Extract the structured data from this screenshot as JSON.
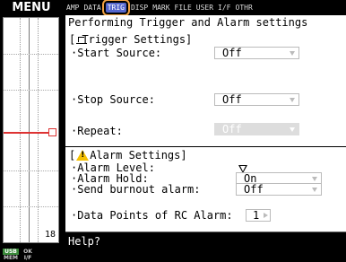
{
  "menu_label": "MENU",
  "tabs": [
    {
      "label": "AMP"
    },
    {
      "label": "DATA"
    },
    {
      "label": "TRIG"
    },
    {
      "label": "DISP"
    },
    {
      "label": "MARK"
    },
    {
      "label": "FILE"
    },
    {
      "label": "USER"
    },
    {
      "label": "I/F"
    },
    {
      "label": "OTHR"
    }
  ],
  "title": "Performing Trigger and Alarm settings",
  "trigger": {
    "heading": "[ Trigger Settings]",
    "start_label": "·Start Source:",
    "start_value": "Off",
    "stop_label": "·Stop Source:",
    "stop_value": "Off",
    "repeat_label": "·Repeat:",
    "repeat_value": "Off"
  },
  "alarm": {
    "heading_open": "[",
    "heading_text": "Alarm Settings]",
    "level_label": "·Alarm Level:",
    "hold_label": "·Alarm Hold:",
    "hold_value": "On",
    "burnout_label": "·Send burnout alarm:",
    "burnout_value": "Off",
    "rc_label": "·Data Points of RC Alarm:",
    "rc_value": "1"
  },
  "trend_value": "18",
  "status": {
    "usb": "USB",
    "mem": "MEM",
    "pc": "OK",
    "tr": "I/F"
  },
  "help": "Help?"
}
